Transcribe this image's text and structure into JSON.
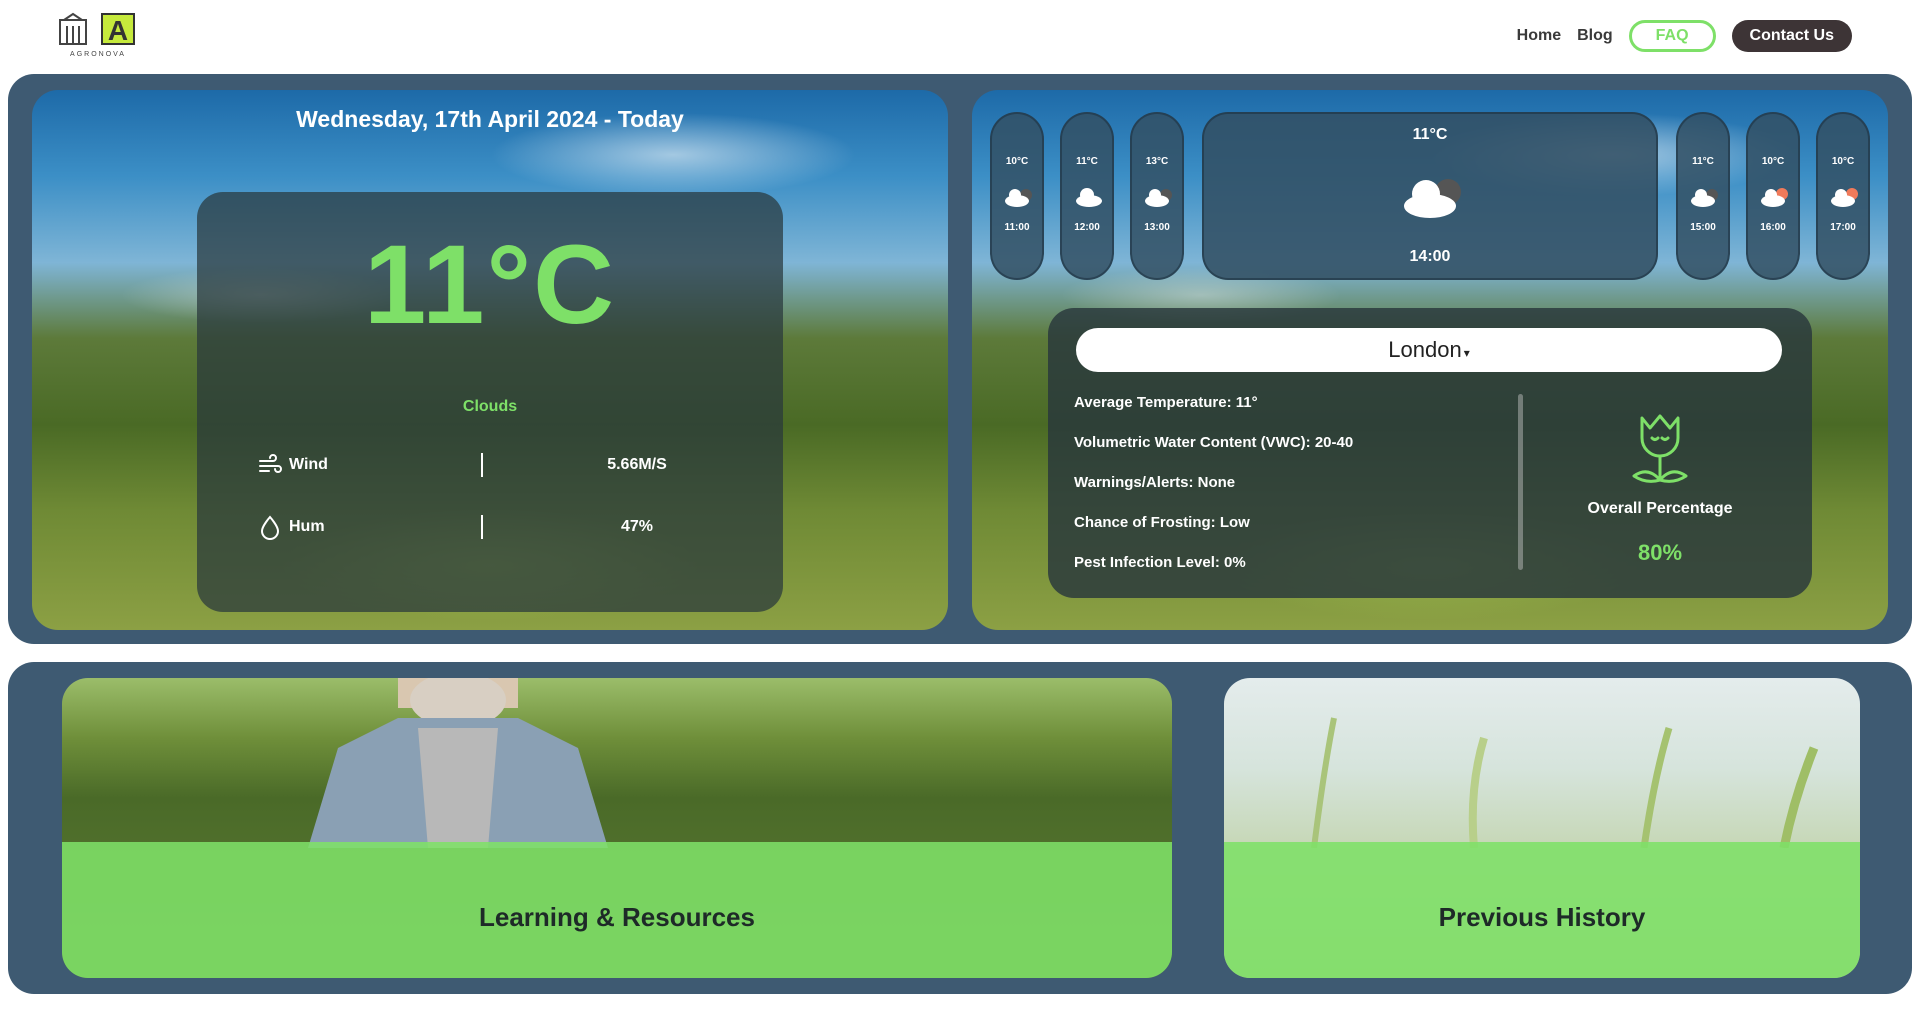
{
  "brand": {
    "logo_letter": "A",
    "logo_text": "AGRONOVA",
    "accent_color": "#7ee068",
    "band_color": "#3e5a72"
  },
  "nav": {
    "home": "Home",
    "blog": "Blog",
    "faq": "FAQ",
    "contact": "Contact Us"
  },
  "today": {
    "date_title": "Wednesday, 17th April 2024 - Today",
    "temperature": "11°C",
    "condition": "Clouds",
    "wind_label": "Wind",
    "wind_value": "5.66M/S",
    "hum_label": "Hum",
    "hum_value": "47%"
  },
  "hourly": [
    {
      "temp": "10°C",
      "time": "11:00",
      "icon": "cloud-icon"
    },
    {
      "temp": "11°C",
      "time": "12:00",
      "icon": "cloud-icon"
    },
    {
      "temp": "13°C",
      "time": "13:00",
      "icon": "cloud-icon"
    },
    {
      "temp": "11°C",
      "time": "15:00",
      "icon": "cloud-icon"
    },
    {
      "temp": "10°C",
      "time": "16:00",
      "icon": "cloud-sun-icon"
    },
    {
      "temp": "10°C",
      "time": "17:00",
      "icon": "cloud-sun-icon"
    }
  ],
  "current_hour": {
    "temp": "11°C",
    "time": "14:00",
    "icon": "cloud-icon"
  },
  "location": {
    "city": "London",
    "avg_temp": "Average Temperature: 11°",
    "vwc": "Volumetric Water Content (VWC): 20-40",
    "warnings": "Warnings/Alerts: None",
    "frost": "Chance of Frosting: Low",
    "pest": "Pest Infection Level: 0%",
    "overall_label": "Overall Percentage",
    "overall_value": "80%"
  },
  "tiles": {
    "learning": "Learning & Resources",
    "history": "Previous History"
  }
}
